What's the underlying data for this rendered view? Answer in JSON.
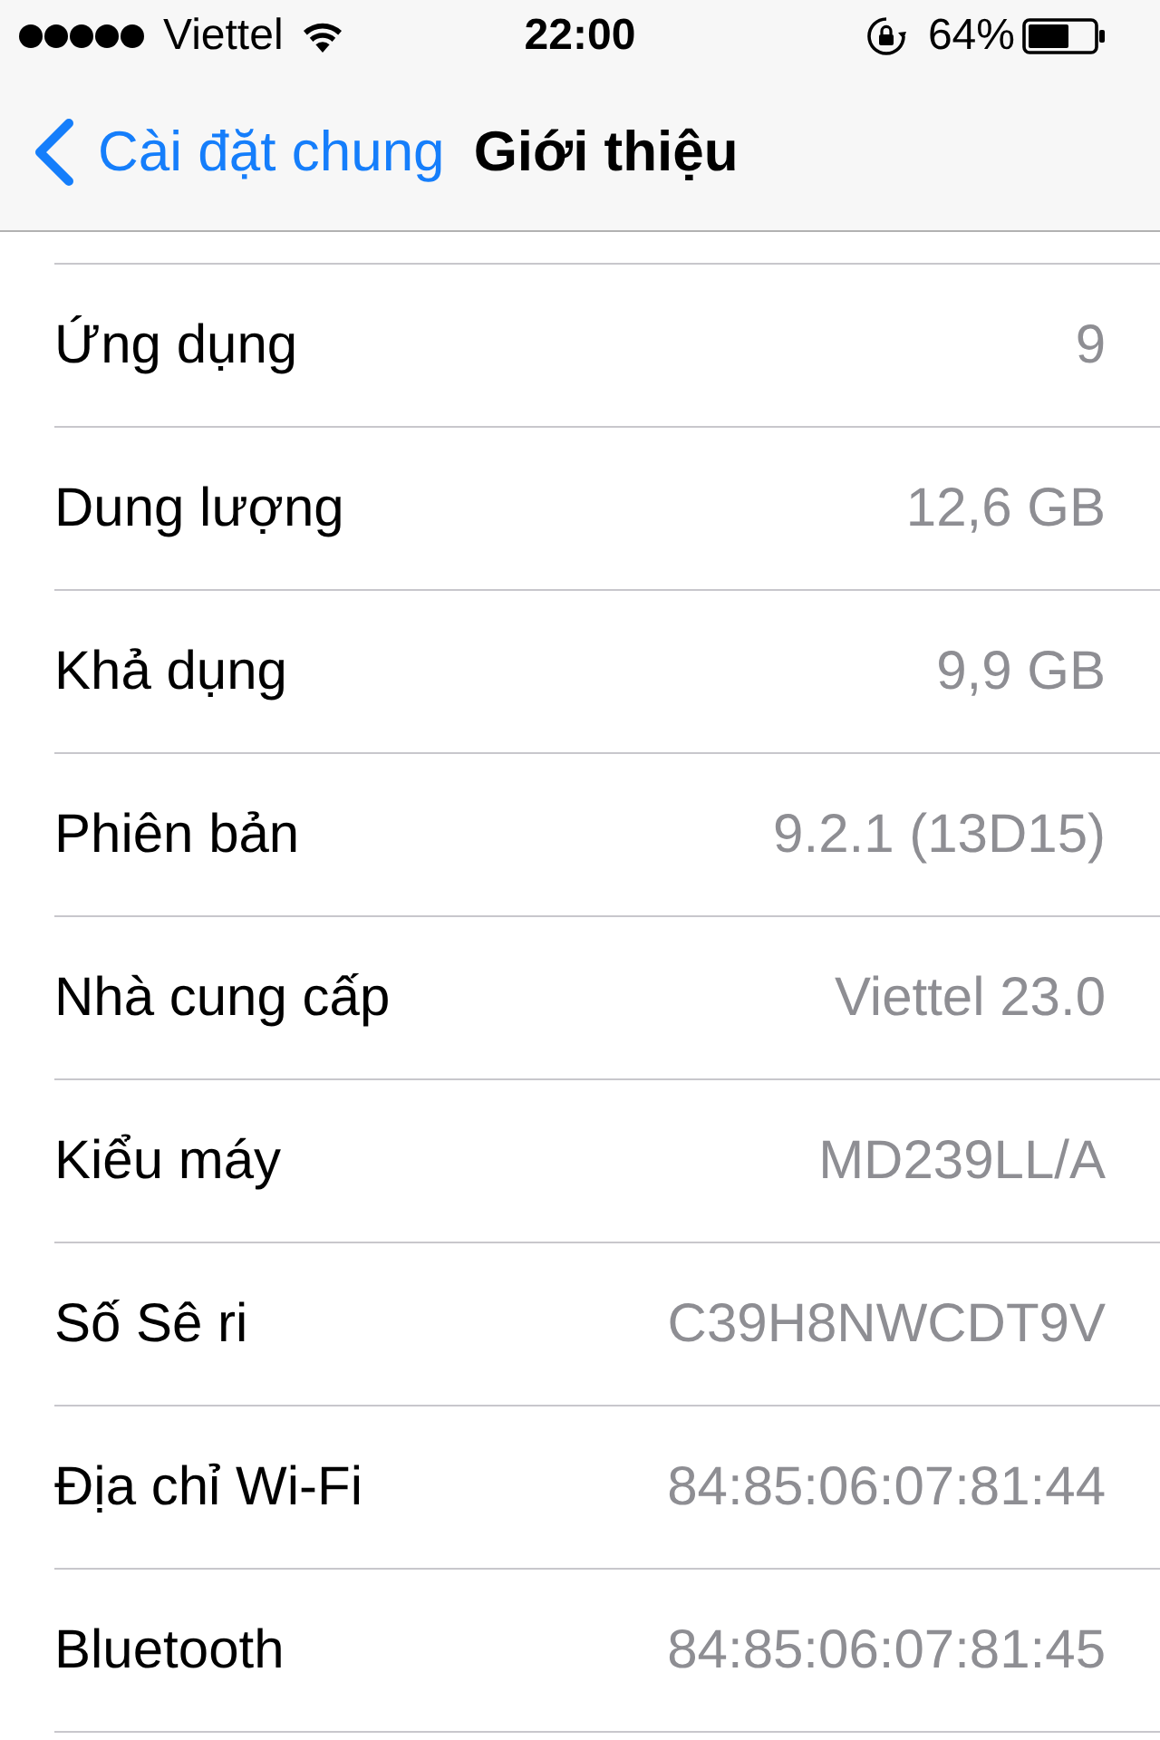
{
  "status_bar": {
    "carrier": "Viettel",
    "time": "22:00",
    "battery": "64%"
  },
  "nav_bar": {
    "back_label": "Cài đặt chung",
    "title": "Giới thiệu"
  },
  "rows": [
    {
      "label": "Ứng dụng",
      "value": "9"
    },
    {
      "label": "Dung lượng",
      "value": "12,6 GB"
    },
    {
      "label": "Khả dụng",
      "value": "9,9 GB"
    },
    {
      "label": "Phiên bản",
      "value": "9.2.1 (13D15)"
    },
    {
      "label": "Nhà cung cấp",
      "value": "Viettel 23.0"
    },
    {
      "label": "Kiểu máy",
      "value": "MD239LL/A"
    },
    {
      "label": "Số Sê ri",
      "value": "C39H8NWCDT9V"
    },
    {
      "label": "Địa chỉ Wi-Fi",
      "value": "84:85:06:07:81:44"
    },
    {
      "label": "Bluetooth",
      "value": "84:85:06:07:81:45"
    }
  ]
}
